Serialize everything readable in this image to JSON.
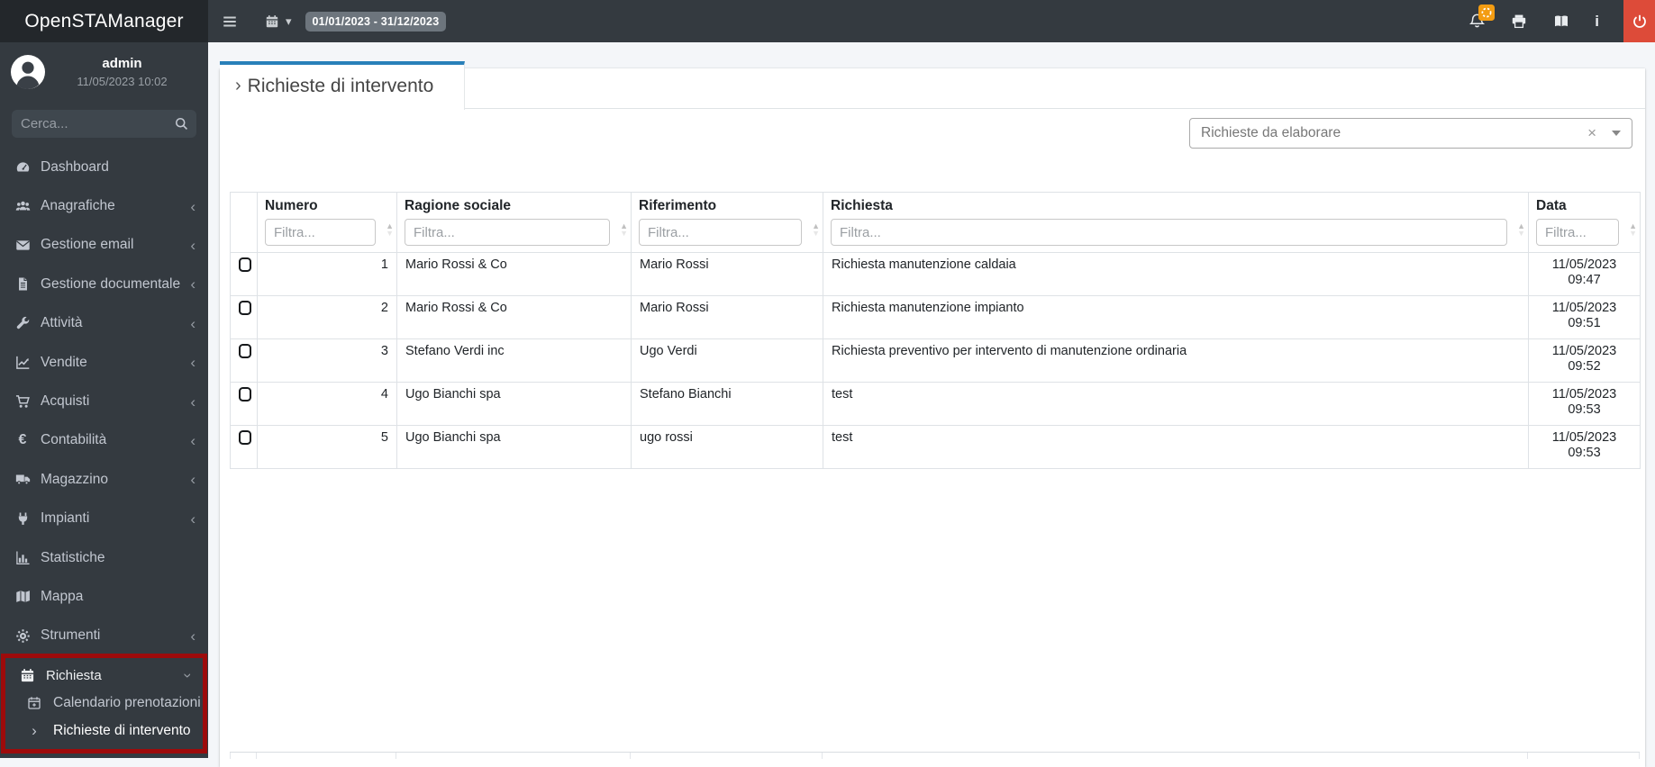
{
  "app": {
    "brand": "OpenSTAManager"
  },
  "topbar": {
    "date_range": "01/01/2023 - 31/12/2023"
  },
  "user": {
    "name": "admin",
    "datetime": "11/05/2023 10:02"
  },
  "search": {
    "placeholder": "Cerca..."
  },
  "sidebar": {
    "items": [
      {
        "label": "Dashboard",
        "icon": "dashboard-icon",
        "has_submenu": false
      },
      {
        "label": "Anagrafiche",
        "icon": "users-icon",
        "has_submenu": true
      },
      {
        "label": "Gestione email",
        "icon": "envelope-icon",
        "has_submenu": true
      },
      {
        "label": "Gestione documentale",
        "icon": "document-icon",
        "has_submenu": true
      },
      {
        "label": "Attività",
        "icon": "wrench-icon",
        "has_submenu": true
      },
      {
        "label": "Vendite",
        "icon": "chart-line-icon",
        "has_submenu": true
      },
      {
        "label": "Acquisti",
        "icon": "cart-icon",
        "has_submenu": true
      },
      {
        "label": "Contabilità",
        "icon": "euro-icon",
        "has_submenu": true
      },
      {
        "label": "Magazzino",
        "icon": "truck-icon",
        "has_submenu": true
      },
      {
        "label": "Impianti",
        "icon": "plug-icon",
        "has_submenu": true
      },
      {
        "label": "Statistiche",
        "icon": "chart-bar-icon",
        "has_submenu": false
      },
      {
        "label": "Mappa",
        "icon": "map-icon",
        "has_submenu": false
      },
      {
        "label": "Strumenti",
        "icon": "gear-icon",
        "has_submenu": true
      }
    ]
  },
  "request_menu": {
    "parent_label": "Richiesta",
    "items": [
      {
        "label": "Calendario prenotazioni",
        "icon": "calendar-plus-icon",
        "active": false
      },
      {
        "label": "Richieste di intervento",
        "icon": "chevron-right-icon",
        "active": true
      }
    ]
  },
  "tab": {
    "title": "Richieste di intervento"
  },
  "filter_select": {
    "value": "Richieste da elaborare"
  },
  "table": {
    "columns": [
      "Numero",
      "Ragione sociale",
      "Riferimento",
      "Richiesta",
      "Data"
    ],
    "filter_placeholder": "Filtra...",
    "rows": [
      {
        "numero": "1",
        "ragione_sociale": "Mario Rossi & Co",
        "riferimento": "Mario Rossi",
        "richiesta": "Richiesta manutenzione caldaia",
        "data": "11/05/2023",
        "ora": "09:47"
      },
      {
        "numero": "2",
        "ragione_sociale": "Mario Rossi & Co",
        "riferimento": "Mario Rossi",
        "richiesta": "Richiesta manutenzione impianto",
        "data": "11/05/2023",
        "ora": "09:51"
      },
      {
        "numero": "3",
        "ragione_sociale": "Stefano Verdi inc",
        "riferimento": "Ugo Verdi",
        "richiesta": "Richiesta preventivo per intervento di manutenzione ordinaria",
        "data": "11/05/2023",
        "ora": "09:52"
      },
      {
        "numero": "4",
        "ragione_sociale": "Ugo Bianchi spa",
        "riferimento": "Stefano Bianchi",
        "richiesta": "test",
        "data": "11/05/2023",
        "ora": "09:53"
      },
      {
        "numero": "5",
        "ragione_sociale": "Ugo Bianchi spa",
        "riferimento": "ugo rossi",
        "richiesta": "test",
        "data": "11/05/2023",
        "ora": "09:53"
      }
    ]
  },
  "icons": {
    "hamburger-icon": "svg",
    "calendar-icon": "svg",
    "caret-down-icon": "▾",
    "bell-icon": "svg",
    "spinner-badge-icon": "svg",
    "print-icon": "svg",
    "book-icon": "svg",
    "info-icon": "i",
    "power-icon": "svg",
    "search-icon": "svg",
    "chevron-left-icon": "‹",
    "chevron-right-icon": "›",
    "close-icon": "×"
  },
  "colors": {
    "accent_blue": "#2980b9",
    "navbar_bg": "#343a40",
    "brand_bg": "#23272b",
    "danger_red": "#dd4b39",
    "warning_orange": "#f39c12",
    "highlight_border": "#9d0b0b"
  }
}
